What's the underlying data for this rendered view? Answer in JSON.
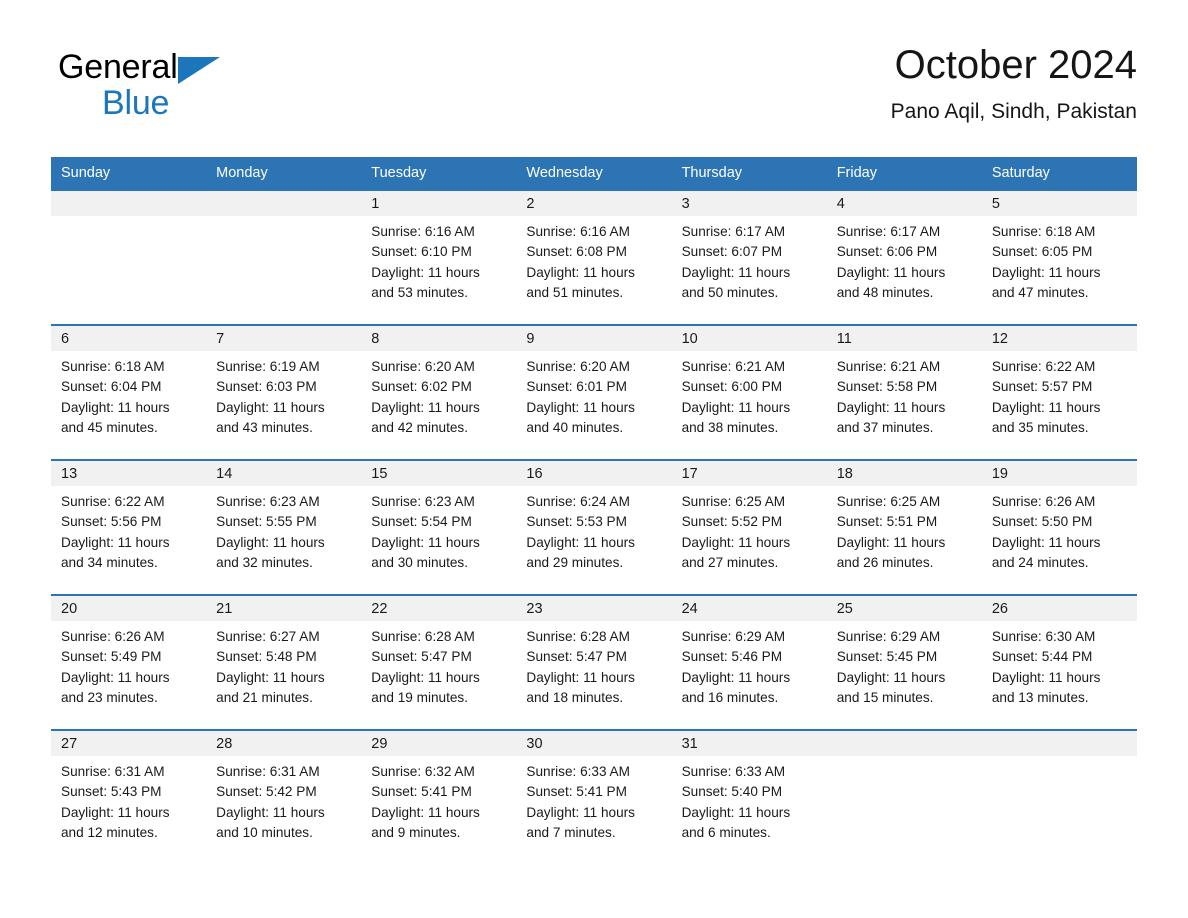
{
  "brand": {
    "word1": "General",
    "word2": "Blue",
    "triangle_color": "#1b76bc"
  },
  "header": {
    "title": "October 2024",
    "subtitle": "Pano Aqil, Sindh, Pakistan"
  },
  "theme": {
    "header_blue": "#2c74b3",
    "row_divider_blue": "#2c74b3",
    "daynum_band": "#f1f1f1",
    "text": "#1a1a1a"
  },
  "weekday_headers": [
    "Sunday",
    "Monday",
    "Tuesday",
    "Wednesday",
    "Thursday",
    "Friday",
    "Saturday"
  ],
  "labels": {
    "sunrise_prefix": "Sunrise: ",
    "sunset_prefix": "Sunset: ",
    "daylight_prefix": "Daylight: "
  },
  "weeks": [
    [
      {
        "day": "",
        "sunrise": "",
        "sunset": "",
        "daylight_line1": "",
        "daylight_line2": ""
      },
      {
        "day": "",
        "sunrise": "",
        "sunset": "",
        "daylight_line1": "",
        "daylight_line2": ""
      },
      {
        "day": "1",
        "sunrise": "Sunrise: 6:16 AM",
        "sunset": "Sunset: 6:10 PM",
        "daylight_line1": "Daylight: 11 hours",
        "daylight_line2": "and 53 minutes."
      },
      {
        "day": "2",
        "sunrise": "Sunrise: 6:16 AM",
        "sunset": "Sunset: 6:08 PM",
        "daylight_line1": "Daylight: 11 hours",
        "daylight_line2": "and 51 minutes."
      },
      {
        "day": "3",
        "sunrise": "Sunrise: 6:17 AM",
        "sunset": "Sunset: 6:07 PM",
        "daylight_line1": "Daylight: 11 hours",
        "daylight_line2": "and 50 minutes."
      },
      {
        "day": "4",
        "sunrise": "Sunrise: 6:17 AM",
        "sunset": "Sunset: 6:06 PM",
        "daylight_line1": "Daylight: 11 hours",
        "daylight_line2": "and 48 minutes."
      },
      {
        "day": "5",
        "sunrise": "Sunrise: 6:18 AM",
        "sunset": "Sunset: 6:05 PM",
        "daylight_line1": "Daylight: 11 hours",
        "daylight_line2": "and 47 minutes."
      }
    ],
    [
      {
        "day": "6",
        "sunrise": "Sunrise: 6:18 AM",
        "sunset": "Sunset: 6:04 PM",
        "daylight_line1": "Daylight: 11 hours",
        "daylight_line2": "and 45 minutes."
      },
      {
        "day": "7",
        "sunrise": "Sunrise: 6:19 AM",
        "sunset": "Sunset: 6:03 PM",
        "daylight_line1": "Daylight: 11 hours",
        "daylight_line2": "and 43 minutes."
      },
      {
        "day": "8",
        "sunrise": "Sunrise: 6:20 AM",
        "sunset": "Sunset: 6:02 PM",
        "daylight_line1": "Daylight: 11 hours",
        "daylight_line2": "and 42 minutes."
      },
      {
        "day": "9",
        "sunrise": "Sunrise: 6:20 AM",
        "sunset": "Sunset: 6:01 PM",
        "daylight_line1": "Daylight: 11 hours",
        "daylight_line2": "and 40 minutes."
      },
      {
        "day": "10",
        "sunrise": "Sunrise: 6:21 AM",
        "sunset": "Sunset: 6:00 PM",
        "daylight_line1": "Daylight: 11 hours",
        "daylight_line2": "and 38 minutes."
      },
      {
        "day": "11",
        "sunrise": "Sunrise: 6:21 AM",
        "sunset": "Sunset: 5:58 PM",
        "daylight_line1": "Daylight: 11 hours",
        "daylight_line2": "and 37 minutes."
      },
      {
        "day": "12",
        "sunrise": "Sunrise: 6:22 AM",
        "sunset": "Sunset: 5:57 PM",
        "daylight_line1": "Daylight: 11 hours",
        "daylight_line2": "and 35 minutes."
      }
    ],
    [
      {
        "day": "13",
        "sunrise": "Sunrise: 6:22 AM",
        "sunset": "Sunset: 5:56 PM",
        "daylight_line1": "Daylight: 11 hours",
        "daylight_line2": "and 34 minutes."
      },
      {
        "day": "14",
        "sunrise": "Sunrise: 6:23 AM",
        "sunset": "Sunset: 5:55 PM",
        "daylight_line1": "Daylight: 11 hours",
        "daylight_line2": "and 32 minutes."
      },
      {
        "day": "15",
        "sunrise": "Sunrise: 6:23 AM",
        "sunset": "Sunset: 5:54 PM",
        "daylight_line1": "Daylight: 11 hours",
        "daylight_line2": "and 30 minutes."
      },
      {
        "day": "16",
        "sunrise": "Sunrise: 6:24 AM",
        "sunset": "Sunset: 5:53 PM",
        "daylight_line1": "Daylight: 11 hours",
        "daylight_line2": "and 29 minutes."
      },
      {
        "day": "17",
        "sunrise": "Sunrise: 6:25 AM",
        "sunset": "Sunset: 5:52 PM",
        "daylight_line1": "Daylight: 11 hours",
        "daylight_line2": "and 27 minutes."
      },
      {
        "day": "18",
        "sunrise": "Sunrise: 6:25 AM",
        "sunset": "Sunset: 5:51 PM",
        "daylight_line1": "Daylight: 11 hours",
        "daylight_line2": "and 26 minutes."
      },
      {
        "day": "19",
        "sunrise": "Sunrise: 6:26 AM",
        "sunset": "Sunset: 5:50 PM",
        "daylight_line1": "Daylight: 11 hours",
        "daylight_line2": "and 24 minutes."
      }
    ],
    [
      {
        "day": "20",
        "sunrise": "Sunrise: 6:26 AM",
        "sunset": "Sunset: 5:49 PM",
        "daylight_line1": "Daylight: 11 hours",
        "daylight_line2": "and 23 minutes."
      },
      {
        "day": "21",
        "sunrise": "Sunrise: 6:27 AM",
        "sunset": "Sunset: 5:48 PM",
        "daylight_line1": "Daylight: 11 hours",
        "daylight_line2": "and 21 minutes."
      },
      {
        "day": "22",
        "sunrise": "Sunrise: 6:28 AM",
        "sunset": "Sunset: 5:47 PM",
        "daylight_line1": "Daylight: 11 hours",
        "daylight_line2": "and 19 minutes."
      },
      {
        "day": "23",
        "sunrise": "Sunrise: 6:28 AM",
        "sunset": "Sunset: 5:47 PM",
        "daylight_line1": "Daylight: 11 hours",
        "daylight_line2": "and 18 minutes."
      },
      {
        "day": "24",
        "sunrise": "Sunrise: 6:29 AM",
        "sunset": "Sunset: 5:46 PM",
        "daylight_line1": "Daylight: 11 hours",
        "daylight_line2": "and 16 minutes."
      },
      {
        "day": "25",
        "sunrise": "Sunrise: 6:29 AM",
        "sunset": "Sunset: 5:45 PM",
        "daylight_line1": "Daylight: 11 hours",
        "daylight_line2": "and 15 minutes."
      },
      {
        "day": "26",
        "sunrise": "Sunrise: 6:30 AM",
        "sunset": "Sunset: 5:44 PM",
        "daylight_line1": "Daylight: 11 hours",
        "daylight_line2": "and 13 minutes."
      }
    ],
    [
      {
        "day": "27",
        "sunrise": "Sunrise: 6:31 AM",
        "sunset": "Sunset: 5:43 PM",
        "daylight_line1": "Daylight: 11 hours",
        "daylight_line2": "and 12 minutes."
      },
      {
        "day": "28",
        "sunrise": "Sunrise: 6:31 AM",
        "sunset": "Sunset: 5:42 PM",
        "daylight_line1": "Daylight: 11 hours",
        "daylight_line2": "and 10 minutes."
      },
      {
        "day": "29",
        "sunrise": "Sunrise: 6:32 AM",
        "sunset": "Sunset: 5:41 PM",
        "daylight_line1": "Daylight: 11 hours",
        "daylight_line2": "and 9 minutes."
      },
      {
        "day": "30",
        "sunrise": "Sunrise: 6:33 AM",
        "sunset": "Sunset: 5:41 PM",
        "daylight_line1": "Daylight: 11 hours",
        "daylight_line2": "and 7 minutes."
      },
      {
        "day": "31",
        "sunrise": "Sunrise: 6:33 AM",
        "sunset": "Sunset: 5:40 PM",
        "daylight_line1": "Daylight: 11 hours",
        "daylight_line2": "and 6 minutes."
      },
      {
        "day": "",
        "sunrise": "",
        "sunset": "",
        "daylight_line1": "",
        "daylight_line2": ""
      },
      {
        "day": "",
        "sunrise": "",
        "sunset": "",
        "daylight_line1": "",
        "daylight_line2": ""
      }
    ]
  ]
}
